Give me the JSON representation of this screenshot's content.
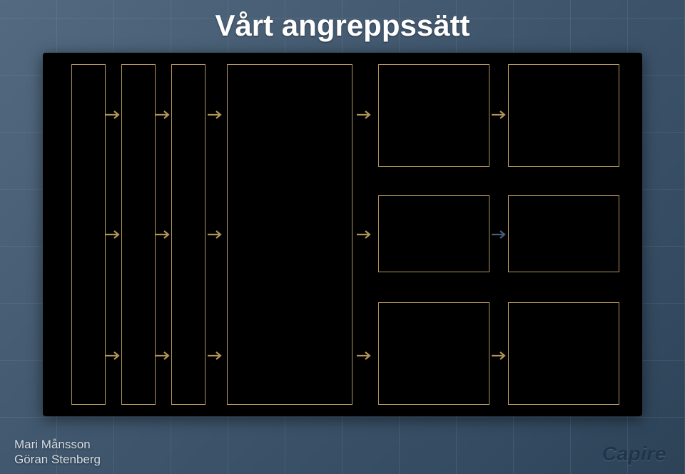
{
  "title": "Vårt angreppssätt",
  "footer": {
    "author1": "Mari Månsson",
    "author2": "Göran Stenberg"
  },
  "brand": "Capire",
  "diagram": {
    "vcol1": {
      "label": ""
    },
    "vcol2": {
      "label": ""
    },
    "vcol3": {
      "label": ""
    },
    "bigbox": {
      "label": ""
    },
    "grid": {
      "r1c1": "",
      "r1c2": "",
      "r2c1": "",
      "r2c2": "",
      "r3c1": "",
      "r3c2": ""
    }
  },
  "arrows": {
    "color_main": "#b4965a",
    "color_alt": "#4a5e7a"
  }
}
